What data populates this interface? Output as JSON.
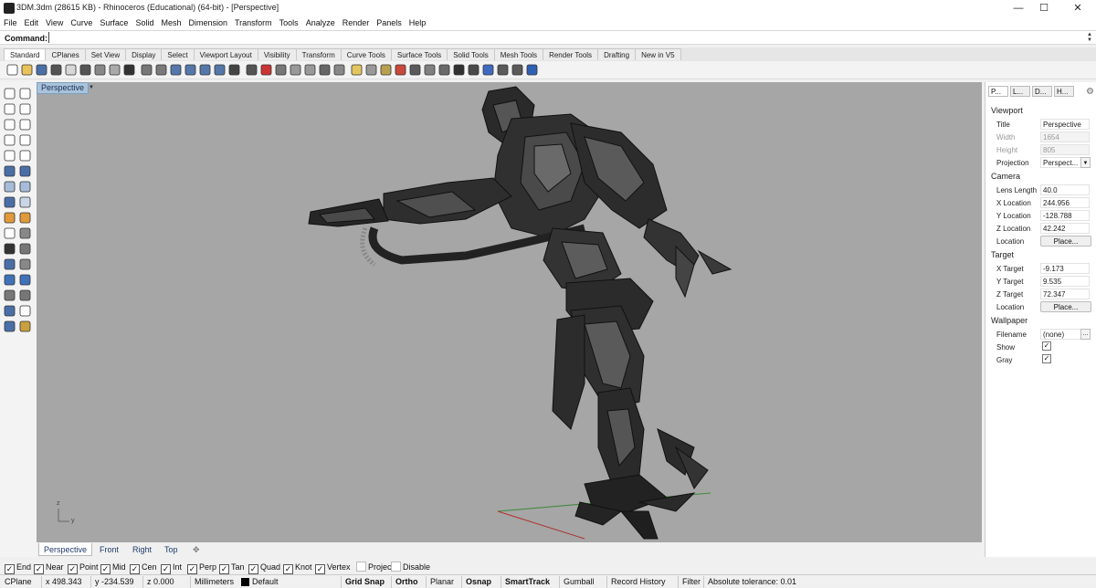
{
  "window": {
    "title": "3DM.3dm (28615 KB) - Rhinoceros (Educational) (64-bit) - [Perspective]",
    "minimize": "—",
    "maximize": "☐",
    "close": "✕"
  },
  "menu": [
    "File",
    "Edit",
    "View",
    "Curve",
    "Surface",
    "Solid",
    "Mesh",
    "Dimension",
    "Transform",
    "Tools",
    "Analyze",
    "Render",
    "Panels",
    "Help"
  ],
  "command": {
    "label": "Command:",
    "value": ""
  },
  "toolbar_tabs": [
    "Standard",
    "CPlanes",
    "Set View",
    "Display",
    "Select",
    "Viewport Layout",
    "Visibility",
    "Transform",
    "Curve Tools",
    "Surface Tools",
    "Solid Tools",
    "Mesh Tools",
    "Render Tools",
    "Drafting",
    "New in V5"
  ],
  "viewport": {
    "title": "Perspective",
    "axis_z": "z",
    "axis_y": "y",
    "axis_x": "x"
  },
  "view_tabs": [
    "Perspective",
    "Front",
    "Right",
    "Top",
    "✥"
  ],
  "panel": {
    "tabs": [
      "P...",
      "L...",
      "D...",
      "H..."
    ],
    "viewport_header": "Viewport",
    "title_label": "Title",
    "title_value": "Perspective",
    "width_label": "Width",
    "width_value": "1654",
    "height_label": "Height",
    "height_value": "805",
    "projection_label": "Projection",
    "projection_value": "Perspect...",
    "camera_header": "Camera",
    "lens_label": "Lens Length",
    "lens_value": "40.0",
    "xloc_label": "X Location",
    "xloc_value": "244.956",
    "yloc_label": "Y Location",
    "yloc_value": "-128.788",
    "zloc_label": "Z Location",
    "zloc_value": "42.242",
    "loc_label": "Location",
    "loc_btn": "Place...",
    "target_header": "Target",
    "xt_label": "X Target",
    "xt_value": "-9.173",
    "yt_label": "Y Target",
    "yt_value": "9.535",
    "zt_label": "Z Target",
    "zt_value": "72.347",
    "tloc_label": "Location",
    "tloc_btn": "Place...",
    "wallpaper_header": "Wallpaper",
    "file_label": "Filename",
    "file_value": "(none)",
    "file_btn": "...",
    "show_label": "Show",
    "gray_label": "Gray"
  },
  "osnaps": [
    {
      "label": "End",
      "checked": true
    },
    {
      "label": "Near",
      "checked": true
    },
    {
      "label": "Point",
      "checked": true
    },
    {
      "label": "Mid",
      "checked": true
    },
    {
      "label": "Cen",
      "checked": true
    },
    {
      "label": "Int",
      "checked": true
    },
    {
      "label": "Perp",
      "checked": true
    },
    {
      "label": "Tan",
      "checked": true
    },
    {
      "label": "Quad",
      "checked": true
    },
    {
      "label": "Knot",
      "checked": true
    },
    {
      "label": "Vertex",
      "checked": true
    },
    {
      "label": "Project",
      "checked": false
    },
    {
      "label": "Disable",
      "checked": false
    }
  ],
  "status": {
    "cplane": "CPlane",
    "x": "x 498.343",
    "y": "y -234.539",
    "z": "z 0.000",
    "units": "Millimeters",
    "layer": "Default",
    "grid_snap": "Grid Snap",
    "ortho": "Ortho",
    "planar": "Planar",
    "osnap": "Osnap",
    "smarttrack": "SmartTrack",
    "gumball": "Gumball",
    "record_history": "Record History",
    "filter": "Filter",
    "tolerance": "Absolute tolerance: 0.01"
  },
  "colors": {
    "viewport_bg": "#a6a6a6",
    "viewport_tab": "#a9c3db",
    "accent": "#1f3a6a"
  }
}
